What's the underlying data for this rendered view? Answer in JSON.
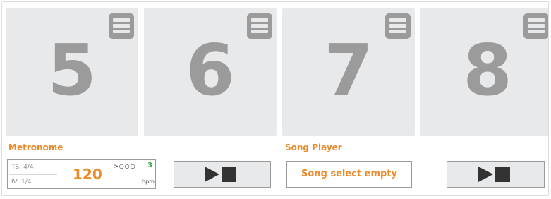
{
  "pads": [
    {
      "number": "5"
    },
    {
      "number": "6"
    },
    {
      "number": "7"
    },
    {
      "number": "8"
    }
  ],
  "metronome": {
    "label": "Metronome",
    "time_signature": "TS: 4/4",
    "interval": "IV: 1/4",
    "tempo": "120",
    "beat_indicator": ">○○○",
    "beat_count": "3",
    "unit": "bpm"
  },
  "song_player": {
    "label": "Song Player",
    "selection": "Song select empty"
  },
  "icons": {
    "menu": "hamburger-menu-icon",
    "play": "play-icon",
    "stop": "stop-icon"
  },
  "colors": {
    "accent": "#ec8a2a",
    "pad_bg": "#e8e9eb",
    "pad_text": "#9b9b9b",
    "beat_count": "#35a74a"
  }
}
